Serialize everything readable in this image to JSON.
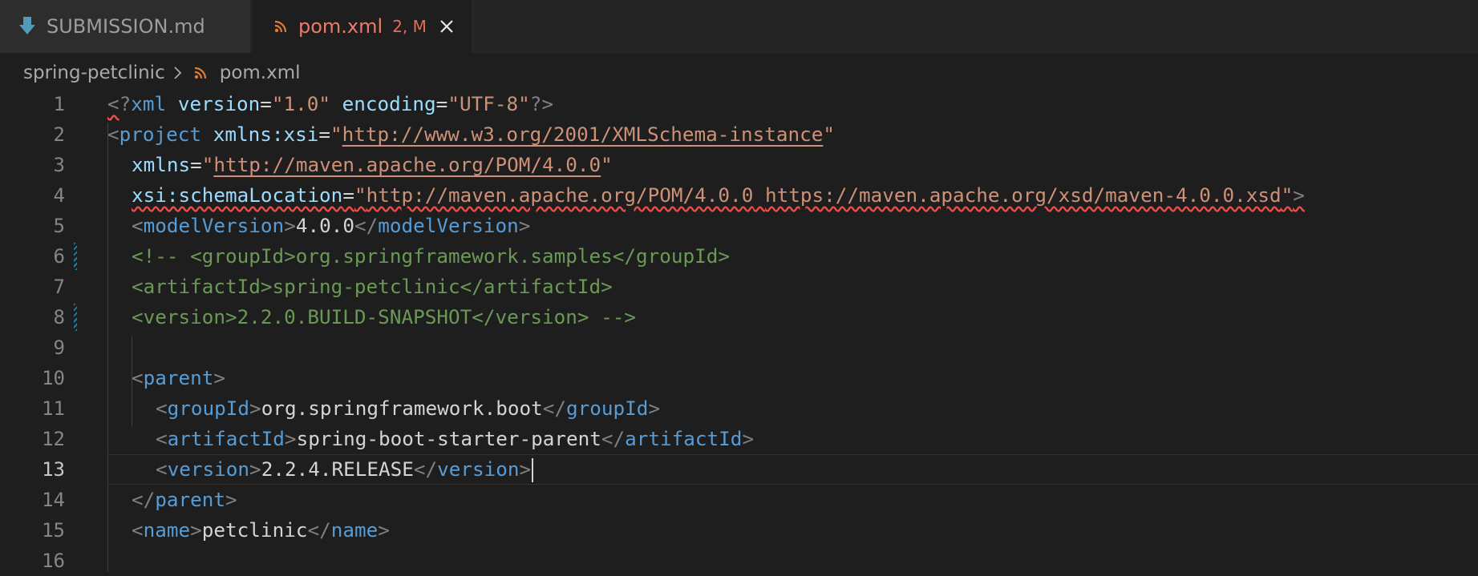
{
  "tabs": [
    {
      "label": "SUBMISSION.md",
      "icon": "download-arrow-icon",
      "active": false
    },
    {
      "label": "pom.xml",
      "icon": "rss-icon",
      "status": "2, M",
      "active": true
    }
  ],
  "breadcrumb": {
    "folder": "spring-petclinic",
    "file": "pom.xml"
  },
  "editor": {
    "current_line": 13,
    "line_numbers": [
      "1",
      "2",
      "3",
      "4",
      "5",
      "6",
      "7",
      "8",
      "9",
      "10",
      "11",
      "12",
      "13",
      "14",
      "15",
      "16"
    ],
    "lines": {
      "l1": {
        "open": "<",
        "q": "?",
        "tag": "xml",
        "a1": "version",
        "eq": "=",
        "v1": "\"1.0\"",
        "a2": "encoding",
        "v2": "\"UTF-8\"",
        "close": "?>"
      },
      "l2": {
        "open": "<",
        "tag": "project",
        "attr": "xmlns:xsi",
        "eq": "=",
        "q": "\"",
        "url": "http://www.w3.org/2001/XMLSchema-instance"
      },
      "l3": {
        "attr": "xmlns",
        "eq": "=",
        "q": "\"",
        "url": "http://maven.apache.org/POM/4.0.0"
      },
      "l4": {
        "attr": "xsi:schemaLocation",
        "eq": "=",
        "q": "\"",
        "url1": "http://maven.apache.org/POM/4.0.0",
        "url2": "https://maven.apache.org/xsd/maven-4.0.0.xsd",
        "close": ">"
      },
      "l5": {
        "tag": "modelVersion",
        "text": "4.0.0"
      },
      "l6": {
        "comment": "<!-- <groupId>org.springframework.samples</groupId>"
      },
      "l7": {
        "comment": "<artifactId>spring-petclinic</artifactId>"
      },
      "l8": {
        "comment": "<version>2.2.0.BUILD-SNAPSHOT</version> -->"
      },
      "l10": {
        "tag": "parent"
      },
      "l11": {
        "tag": "groupId",
        "text": "org.springframework.boot"
      },
      "l12": {
        "tag": "artifactId",
        "text": "spring-boot-starter-parent"
      },
      "l13": {
        "tag": "version",
        "text": "2.2.4.RELEASE"
      },
      "l14": {
        "tag": "parent"
      },
      "l15": {
        "tag": "name",
        "text": "petclinic"
      }
    }
  },
  "colors": {
    "background": "#1e1e1e",
    "tag": "#569cd6",
    "attribute": "#9cdcfe",
    "string": "#ce9178",
    "comment": "#6a9955",
    "active_tab_text": "#ec7a6b"
  }
}
